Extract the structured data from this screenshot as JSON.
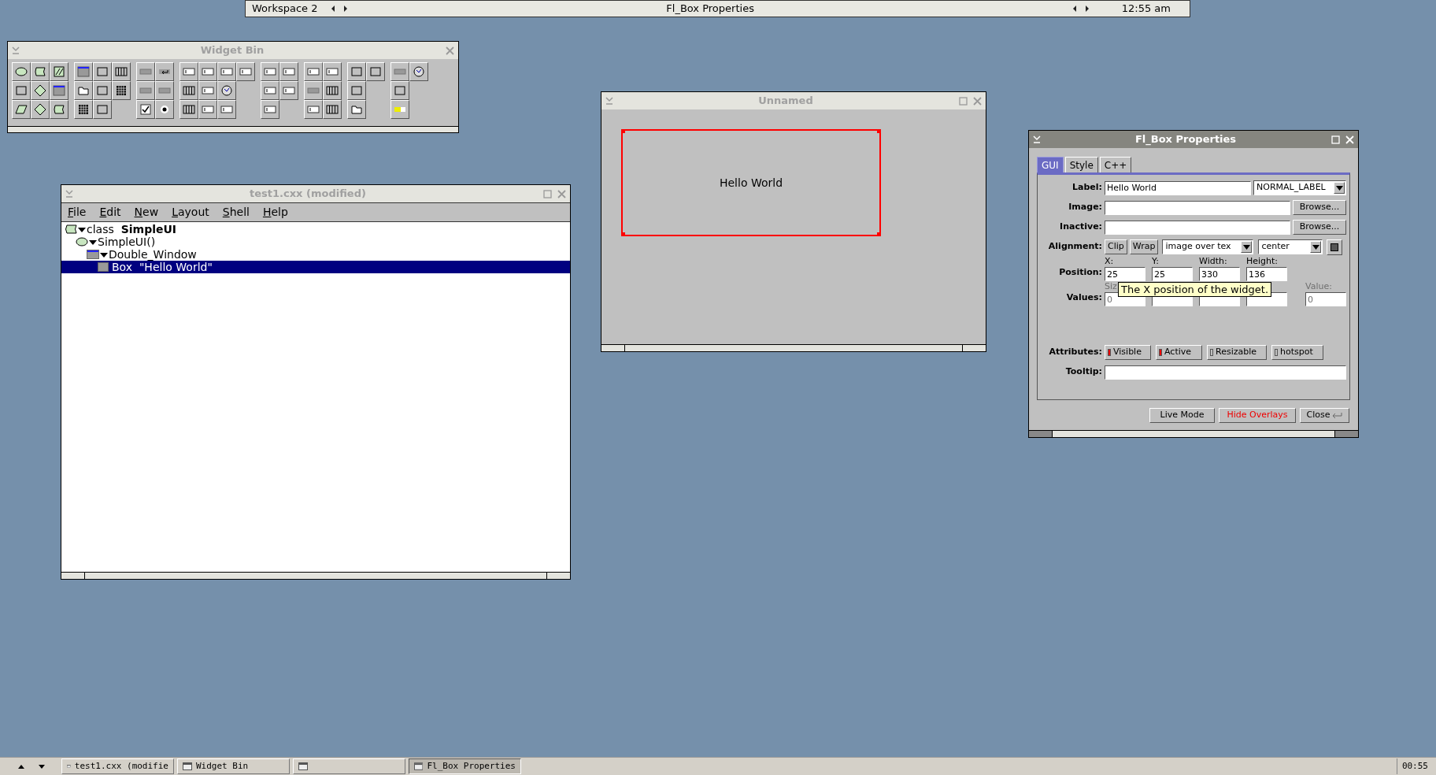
{
  "top_bar": {
    "workspace": "Workspace 2",
    "title": "Fl_Box Properties",
    "clock": "12:55 am"
  },
  "widget_bin": {
    "title": "Widget Bin",
    "active": false
  },
  "project_window": {
    "title": "test1.cxx (modified)",
    "active": false,
    "menu": [
      "File",
      "Edit",
      "New",
      "Layout",
      "Shell",
      "Help"
    ],
    "tree": [
      {
        "label": "class  **SimpleUI**",
        "kind": "class",
        "expanded": true,
        "selected": false,
        "children": [
          {
            "label": "SimpleUI()",
            "kind": "function",
            "expanded": true,
            "selected": false,
            "children": [
              {
                "label": "Double_Window",
                "kind": "window",
                "expanded": true,
                "selected": false,
                "children": [
                  {
                    "label": "Box  \"Hello World\"",
                    "kind": "box",
                    "selected": true
                  }
                ]
              }
            ]
          }
        ]
      }
    ]
  },
  "design_window": {
    "title": "Unnamed",
    "active": false,
    "box": {
      "label": "Hello World",
      "selected": true
    }
  },
  "properties_window": {
    "title": "Fl_Box Properties",
    "active": true,
    "tabs": [
      {
        "label": "GUI",
        "selected": true
      },
      {
        "label": "Style",
        "selected": false
      },
      {
        "label": "C++",
        "selected": false
      }
    ],
    "label_row": {
      "label": "Label:",
      "value": "Hello World",
      "type": "NORMAL_LABEL"
    },
    "image_row": {
      "label": "Image:",
      "button": "Browse..."
    },
    "inactive_row": {
      "label": "Inactive:",
      "button": "Browse..."
    },
    "alignment_row": {
      "label": "Alignment:",
      "buttons": [
        "Clip",
        "Wrap"
      ],
      "image_mode": "image over tex",
      "align": "center"
    },
    "position_row": {
      "label": "Position:",
      "fields": [
        {
          "caption": "X:",
          "value": "25"
        },
        {
          "caption": "Y:",
          "value": "25"
        },
        {
          "caption": "Width:",
          "value": "330"
        },
        {
          "caption": "Height:",
          "value": "136"
        }
      ]
    },
    "values_row": {
      "label": "Values:",
      "fields": [
        {
          "caption": "Siz",
          "value": "0",
          "disabled": true
        },
        {
          "disabled": true
        },
        {
          "disabled": true
        },
        {
          "disabled": true
        },
        {
          "caption": "Value:",
          "value": "0",
          "disabled": true
        }
      ]
    },
    "tooltip_popup": "The X position of the widget.",
    "attributes_row": {
      "label": "Attributes:",
      "items": [
        {
          "label": "Visible",
          "on": true
        },
        {
          "label": "Active",
          "on": true
        },
        {
          "label": "Resizable",
          "on": false
        },
        {
          "label": "hotspot",
          "on": false
        }
      ]
    },
    "tooltip_row": {
      "label": "Tooltip:"
    },
    "buttons": [
      {
        "label": "Live Mode",
        "active": false
      },
      {
        "label": "Hide Overlays",
        "active": true
      },
      {
        "label": "Close",
        "active": false
      }
    ]
  },
  "taskbar": {
    "tasks": [
      {
        "label": "test1.cxx (modifie",
        "selected": false
      },
      {
        "label": "Widget Bin",
        "selected": false
      },
      {
        "selected": false
      },
      {
        "label": "Fl_Box Properties",
        "selected": true
      }
    ],
    "clock": "00:55"
  }
}
